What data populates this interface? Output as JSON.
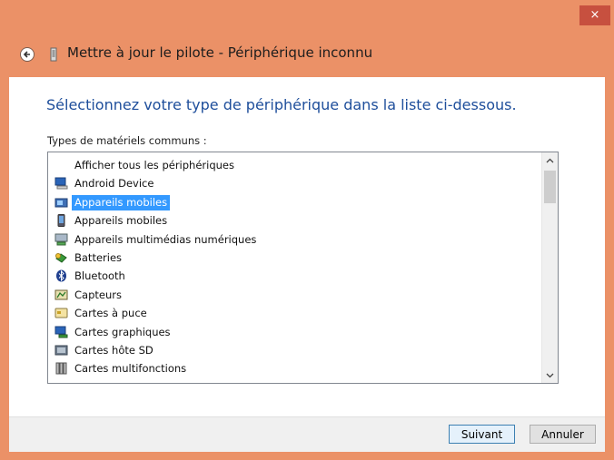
{
  "window": {
    "title": "Mettre à jour le pilote - Périphérique inconnu",
    "close_glyph": "×",
    "accent_color": "#EB9167"
  },
  "page": {
    "heading": "Sélectionnez votre type de périphérique dans la liste ci-dessous.",
    "list_label": "Types de matériels communs :"
  },
  "device_list": {
    "items": [
      {
        "label": "Afficher tous les périphériques",
        "icon": "none",
        "selected": false
      },
      {
        "label": "Android Device",
        "icon": "computer-icon",
        "selected": false
      },
      {
        "label": "Appareils mobiles",
        "icon": "mobile-device-icon",
        "selected": true
      },
      {
        "label": "Appareils mobiles",
        "icon": "phone-icon",
        "selected": false
      },
      {
        "label": "Appareils multimédias numériques",
        "icon": "media-device-icon",
        "selected": false
      },
      {
        "label": "Batteries",
        "icon": "battery-icon",
        "selected": false
      },
      {
        "label": "Bluetooth",
        "icon": "bluetooth-icon",
        "selected": false
      },
      {
        "label": "Capteurs",
        "icon": "sensor-icon",
        "selected": false
      },
      {
        "label": "Cartes à puce",
        "icon": "smart-card-icon",
        "selected": false
      },
      {
        "label": "Cartes graphiques",
        "icon": "display-adapter-icon",
        "selected": false
      },
      {
        "label": "Cartes hôte SD",
        "icon": "sd-host-icon",
        "selected": false
      },
      {
        "label": "Cartes multifonctions",
        "icon": "multifunction-icon",
        "selected": false
      }
    ],
    "selection_color": "#3399FF"
  },
  "buttons": {
    "next": "Suivant",
    "cancel": "Annuler"
  }
}
